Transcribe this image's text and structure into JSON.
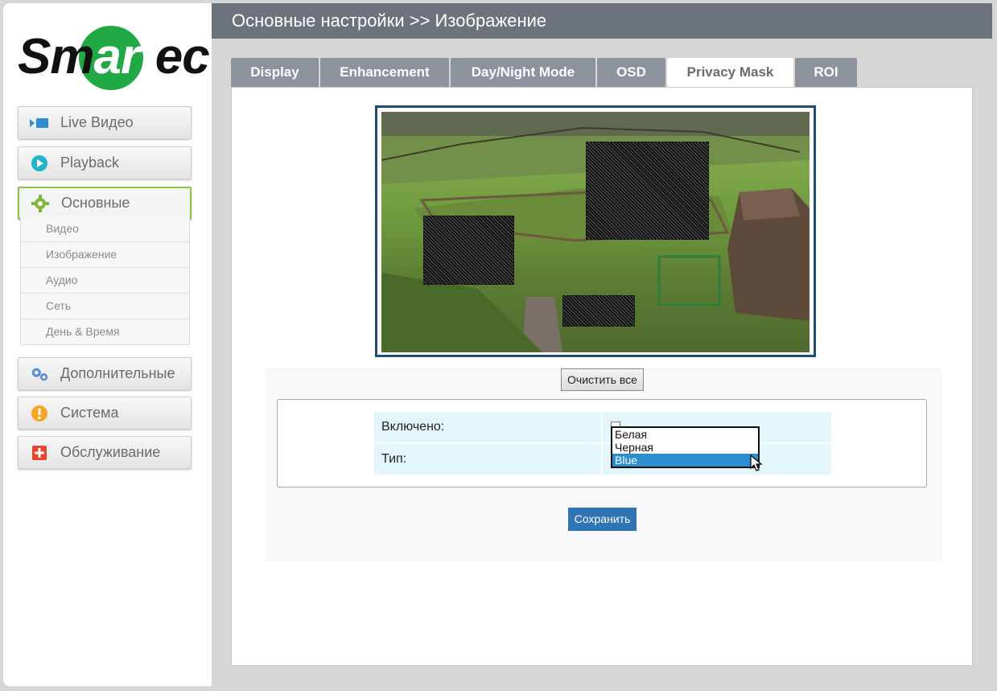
{
  "brand": {
    "logo_text": "Smartec",
    "logo_color": "#21a945"
  },
  "header": {
    "title": "Основные настройки >> Изображение"
  },
  "sidebar": {
    "items": [
      {
        "label": "Live Видео",
        "icon": "live-video-icon"
      },
      {
        "label": "Playback",
        "icon": "play-circle-icon"
      },
      {
        "label": "Основные",
        "icon": "gear-icon",
        "active": true
      },
      {
        "label": "Дополнительные",
        "icon": "gears-icon"
      },
      {
        "label": "Система",
        "icon": "warning-icon"
      },
      {
        "label": "Обслуживание",
        "icon": "plus-square-icon"
      }
    ],
    "submenu": [
      "Видео",
      "Изображение",
      "Аудио",
      "Сеть",
      "День & Время"
    ]
  },
  "tabs": [
    "Display",
    "Enhancement",
    "Day/Night Mode",
    "OSD",
    "Privacy Mask",
    "ROI"
  ],
  "active_tab": "Privacy Mask",
  "privacy_mask": {
    "clear_button": "Очистить все",
    "enabled_label": "Включено:",
    "type_label": "Тип:",
    "type_options": [
      "Белая",
      "Черная",
      "Blue"
    ],
    "type_selected": "Blue",
    "save_button": "Сохранить"
  },
  "colors": {
    "header_bg": "#6d737b",
    "tab_bg": "#8c939c",
    "accent_blue": "#2f74b5",
    "active_green": "#8bc34a"
  }
}
